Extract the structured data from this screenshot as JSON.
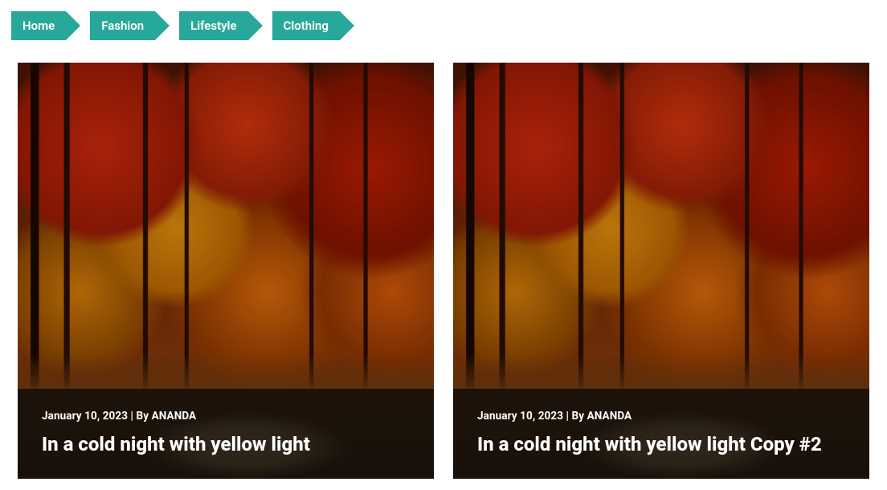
{
  "breadcrumbs": [
    {
      "label": "Home"
    },
    {
      "label": "Fashion"
    },
    {
      "label": "Lifestyle"
    },
    {
      "label": "Clothing"
    }
  ],
  "cards": [
    {
      "date": "January 10, 2023",
      "by_prefix": "By",
      "author": "ANANDA",
      "title": "In a cold night with yellow light"
    },
    {
      "date": "January 10, 2023",
      "by_prefix": "By",
      "author": "ANANDA",
      "title": "In a cold night with yellow light Copy #2"
    }
  ],
  "separator": " | "
}
